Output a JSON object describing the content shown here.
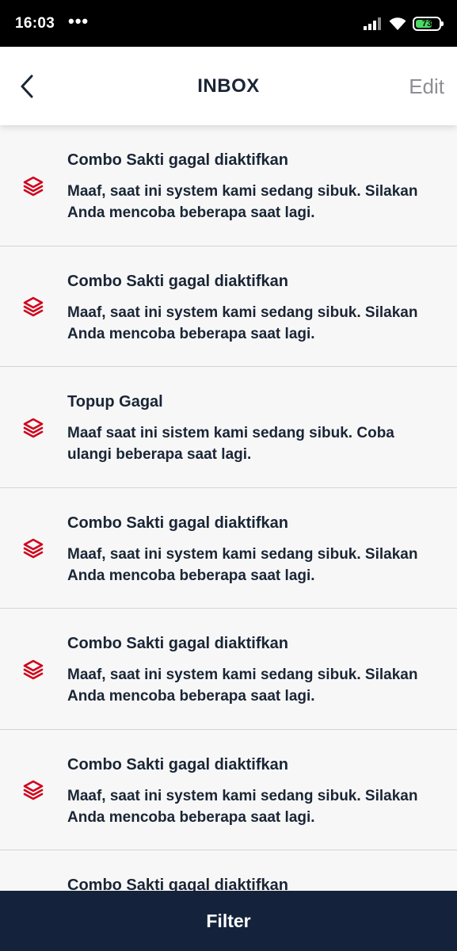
{
  "status_bar": {
    "time": "16:03",
    "dots": "•••",
    "battery": "73",
    "battery_level_percent": 73,
    "icons": [
      "signal-icon",
      "wifi-icon",
      "battery-icon"
    ]
  },
  "header": {
    "title": "INBOX",
    "edit_label": "Edit",
    "back_icon": "chevron-left-icon"
  },
  "inbox": {
    "items": [
      {
        "title": "Combo Sakti gagal diaktifkan",
        "body": "Maaf, saat ini system kami sedang sibuk. Silakan Anda mencoba beberapa saat lagi.",
        "icon": "layers-icon"
      },
      {
        "title": "Combo Sakti gagal diaktifkan",
        "body": "Maaf, saat ini system kami sedang sibuk. Silakan Anda mencoba beberapa saat lagi.",
        "icon": "layers-icon"
      },
      {
        "title": "Topup Gagal",
        "body": "Maaf saat ini sistem kami sedang sibuk. Coba ulangi beberapa saat lagi.",
        "icon": "layers-icon"
      },
      {
        "title": "Combo Sakti gagal diaktifkan",
        "body": "Maaf, saat ini system kami sedang sibuk. Silakan Anda mencoba beberapa saat lagi.",
        "icon": "layers-icon"
      },
      {
        "title": "Combo Sakti gagal diaktifkan",
        "body": "Maaf, saat ini system kami sedang sibuk. Silakan Anda mencoba beberapa saat lagi.",
        "icon": "layers-icon"
      },
      {
        "title": "Combo Sakti gagal diaktifkan",
        "body": "Maaf, saat ini system kami sedang sibuk. Silakan Anda mencoba beberapa saat lagi.",
        "icon": "layers-icon"
      },
      {
        "title": "Combo Sakti gagal diaktifkan",
        "body": "",
        "icon": "layers-icon"
      }
    ]
  },
  "footer": {
    "filter_label": "Filter"
  },
  "colors": {
    "accent_red": "#d0021b",
    "navy": "#14233b",
    "text_dark": "#1a2535",
    "edit_gray": "#8e8e93",
    "battery_green": "#4cd964"
  }
}
